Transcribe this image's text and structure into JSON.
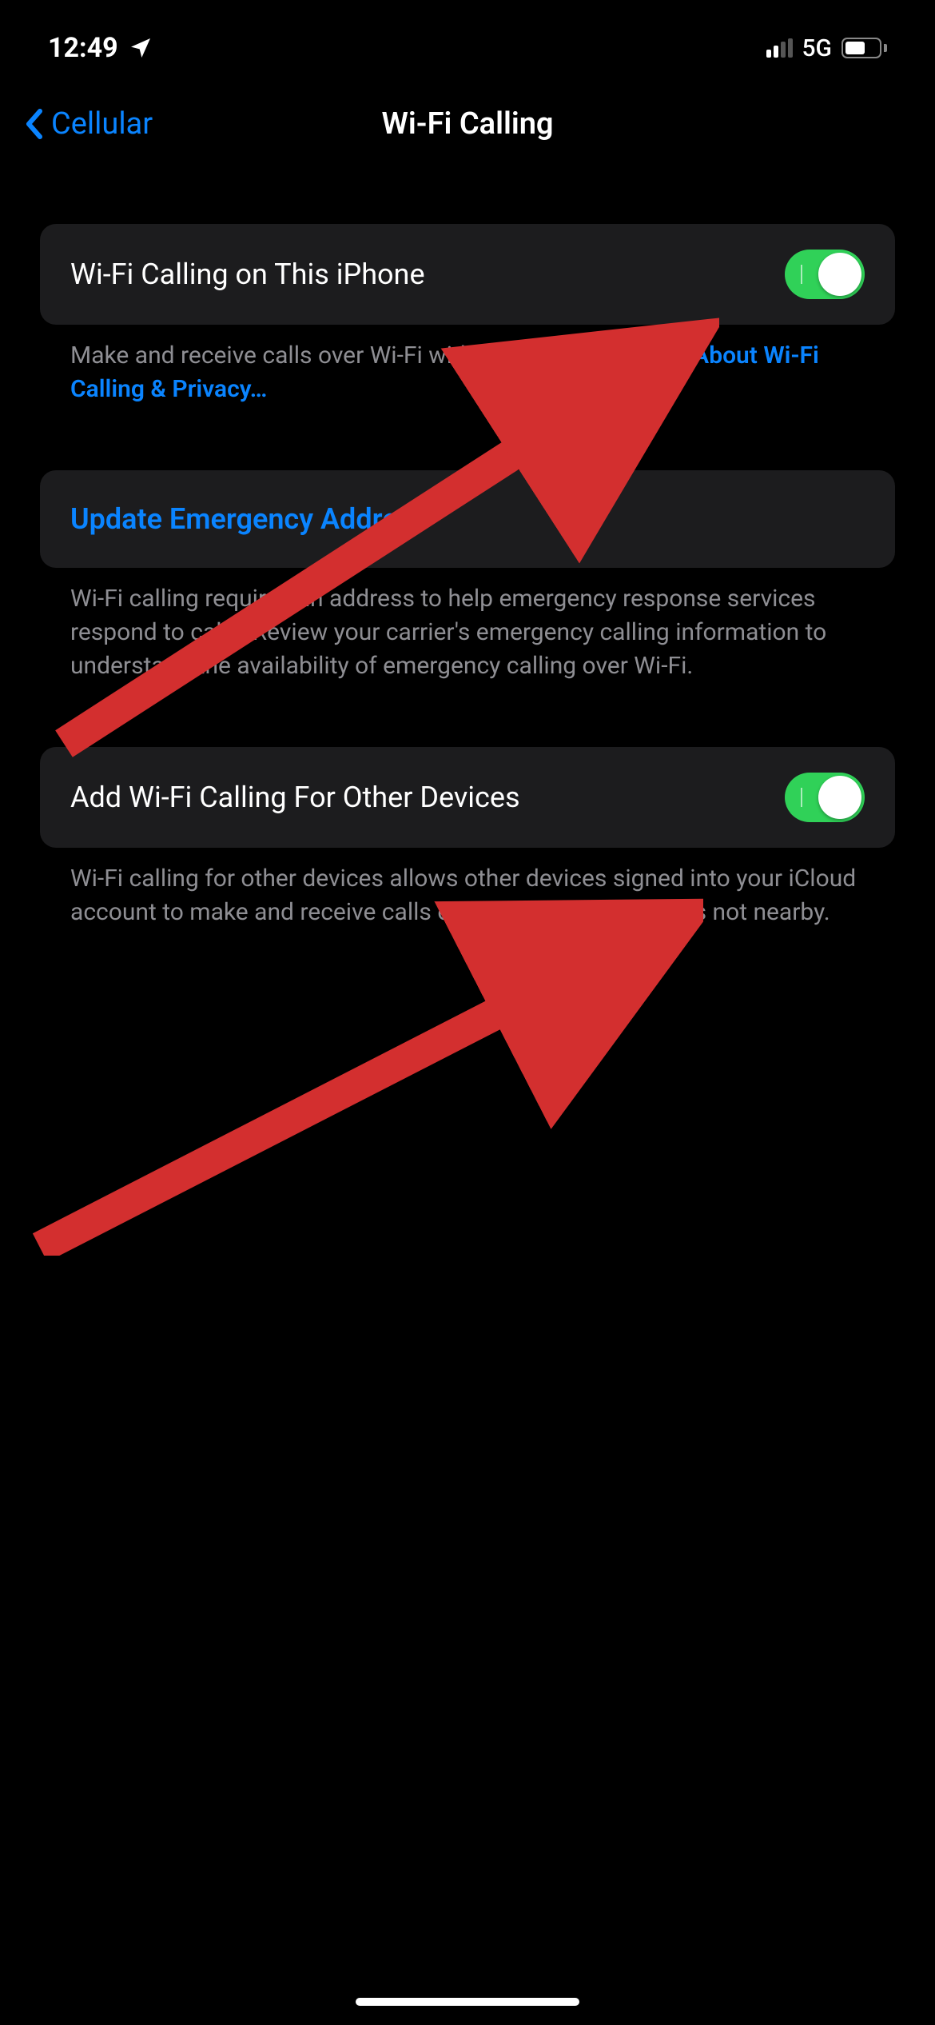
{
  "status": {
    "time": "12:49",
    "network_type": "5G"
  },
  "nav": {
    "back_label": "Cellular",
    "title": "Wi-Fi Calling"
  },
  "rows": {
    "wifi_calling": {
      "label": "Wi-Fi Calling on This iPhone",
      "footer_prefix": "Make and receive calls over Wi-Fi with your AT&T account. ",
      "footer_link": "About Wi-Fi Calling & Privacy…",
      "toggle_on": true
    },
    "emergency": {
      "label": "Update Emergency Address",
      "footer": "Wi-Fi calling requires an address to help emergency response services respond to calls. Review your carrier's emergency calling information to understand the availability of emergency calling over Wi-Fi."
    },
    "other_devices": {
      "label": "Add Wi-Fi Calling For Other Devices",
      "footer": "Wi-Fi calling for other devices allows other devices signed into your iCloud account to make and receive calls even when your iPhone is not nearby.",
      "toggle_on": true
    }
  }
}
